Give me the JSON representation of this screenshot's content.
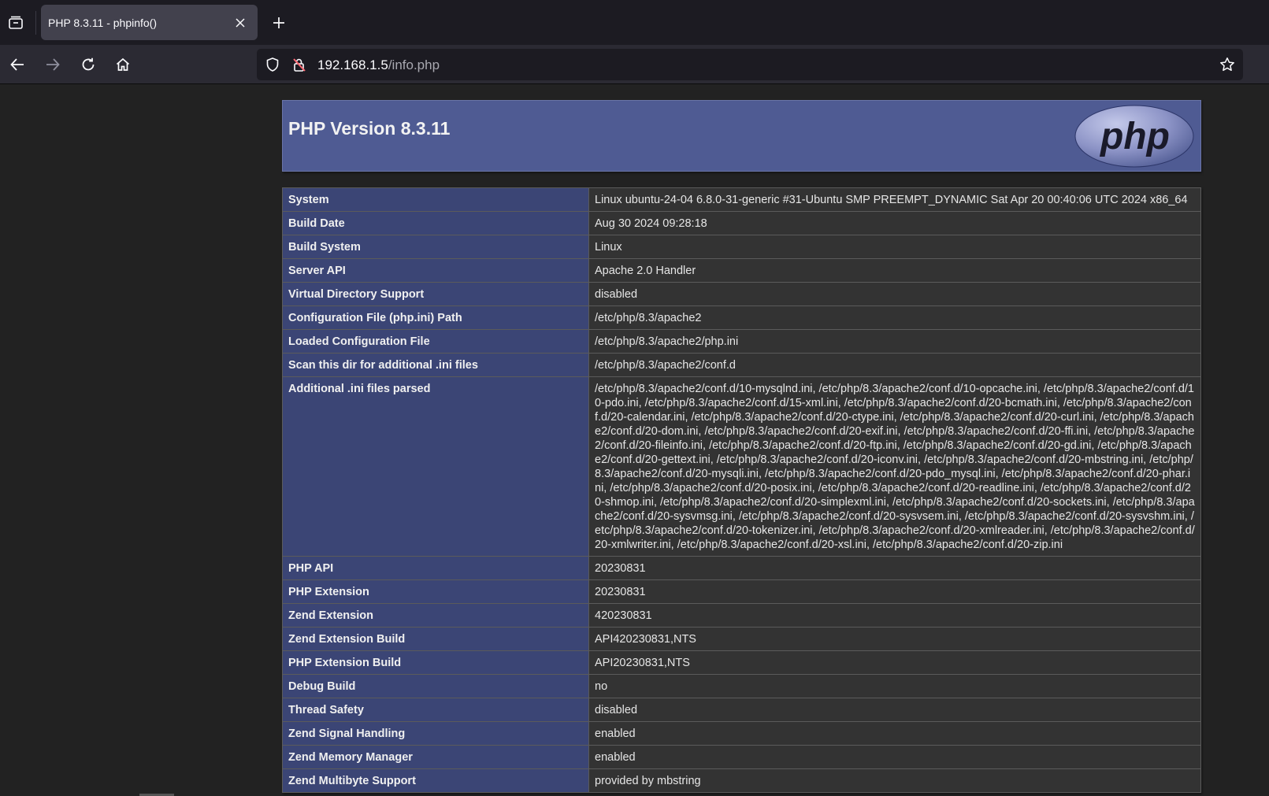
{
  "browser": {
    "tab_title": "PHP 8.3.11 - phpinfo()",
    "url_host": "192.168.1.5",
    "url_path": "/info.php"
  },
  "icons": {
    "tab_list": "tab-list-icon",
    "close_tab": "close-icon",
    "new_tab": "plus-icon",
    "back": "arrow-left-icon",
    "forward": "arrow-right-icon",
    "reload": "reload-icon",
    "home": "home-icon",
    "tracking": "shield-icon",
    "insecure": "lock-warning-icon",
    "bookmark": "star-icon"
  },
  "header": {
    "title": "PHP Version 8.3.11",
    "logo_text": "php"
  },
  "colors": {
    "header_bg": "#4f5b93",
    "key_bg": "#3b4575",
    "value_bg": "#333333",
    "page_bg": "#222222"
  },
  "rows": [
    {
      "key": "System",
      "value": "Linux ubuntu-24-04 6.8.0-31-generic #31-Ubuntu SMP PREEMPT_DYNAMIC Sat Apr 20 00:40:06 UTC 2024 x86_64"
    },
    {
      "key": "Build Date",
      "value": "Aug 30 2024 09:28:18"
    },
    {
      "key": "Build System",
      "value": "Linux"
    },
    {
      "key": "Server API",
      "value": "Apache 2.0 Handler"
    },
    {
      "key": "Virtual Directory Support",
      "value": "disabled"
    },
    {
      "key": "Configuration File (php.ini) Path",
      "value": "/etc/php/8.3/apache2"
    },
    {
      "key": "Loaded Configuration File",
      "value": "/etc/php/8.3/apache2/php.ini"
    },
    {
      "key": "Scan this dir for additional .ini files",
      "value": "/etc/php/8.3/apache2/conf.d"
    },
    {
      "key": "Additional .ini files parsed",
      "value": "/etc/php/8.3/apache2/conf.d/10-mysqlnd.ini, /etc/php/8.3/apache2/conf.d/10-opcache.ini, /etc/php/8.3/apache2/conf.d/10-pdo.ini, /etc/php/8.3/apache2/conf.d/15-xml.ini, /etc/php/8.3/apache2/conf.d/20-bcmath.ini, /etc/php/8.3/apache2/conf.d/20-calendar.ini, /etc/php/8.3/apache2/conf.d/20-ctype.ini, /etc/php/8.3/apache2/conf.d/20-curl.ini, /etc/php/8.3/apache2/conf.d/20-dom.ini, /etc/php/8.3/apache2/conf.d/20-exif.ini, /etc/php/8.3/apache2/conf.d/20-ffi.ini, /etc/php/8.3/apache2/conf.d/20-fileinfo.ini, /etc/php/8.3/apache2/conf.d/20-ftp.ini, /etc/php/8.3/apache2/conf.d/20-gd.ini, /etc/php/8.3/apache2/conf.d/20-gettext.ini, /etc/php/8.3/apache2/conf.d/20-iconv.ini, /etc/php/8.3/apache2/conf.d/20-mbstring.ini, /etc/php/8.3/apache2/conf.d/20-mysqli.ini, /etc/php/8.3/apache2/conf.d/20-pdo_mysql.ini, /etc/php/8.3/apache2/conf.d/20-phar.ini, /etc/php/8.3/apache2/conf.d/20-posix.ini, /etc/php/8.3/apache2/conf.d/20-readline.ini, /etc/php/8.3/apache2/conf.d/20-shmop.ini, /etc/php/8.3/apache2/conf.d/20-simplexml.ini, /etc/php/8.3/apache2/conf.d/20-sockets.ini, /etc/php/8.3/apache2/conf.d/20-sysvmsg.ini, /etc/php/8.3/apache2/conf.d/20-sysvsem.ini, /etc/php/8.3/apache2/conf.d/20-sysvshm.ini, /etc/php/8.3/apache2/conf.d/20-tokenizer.ini, /etc/php/8.3/apache2/conf.d/20-xmlreader.ini, /etc/php/8.3/apache2/conf.d/20-xmlwriter.ini, /etc/php/8.3/apache2/conf.d/20-xsl.ini, /etc/php/8.3/apache2/conf.d/20-zip.ini"
    },
    {
      "key": "PHP API",
      "value": "20230831"
    },
    {
      "key": "PHP Extension",
      "value": "20230831"
    },
    {
      "key": "Zend Extension",
      "value": "420230831"
    },
    {
      "key": "Zend Extension Build",
      "value": "API420230831,NTS"
    },
    {
      "key": "PHP Extension Build",
      "value": "API20230831,NTS"
    },
    {
      "key": "Debug Build",
      "value": "no"
    },
    {
      "key": "Thread Safety",
      "value": "disabled"
    },
    {
      "key": "Zend Signal Handling",
      "value": "enabled"
    },
    {
      "key": "Zend Memory Manager",
      "value": "enabled"
    },
    {
      "key": "Zend Multibyte Support",
      "value": "provided by mbstring"
    }
  ]
}
